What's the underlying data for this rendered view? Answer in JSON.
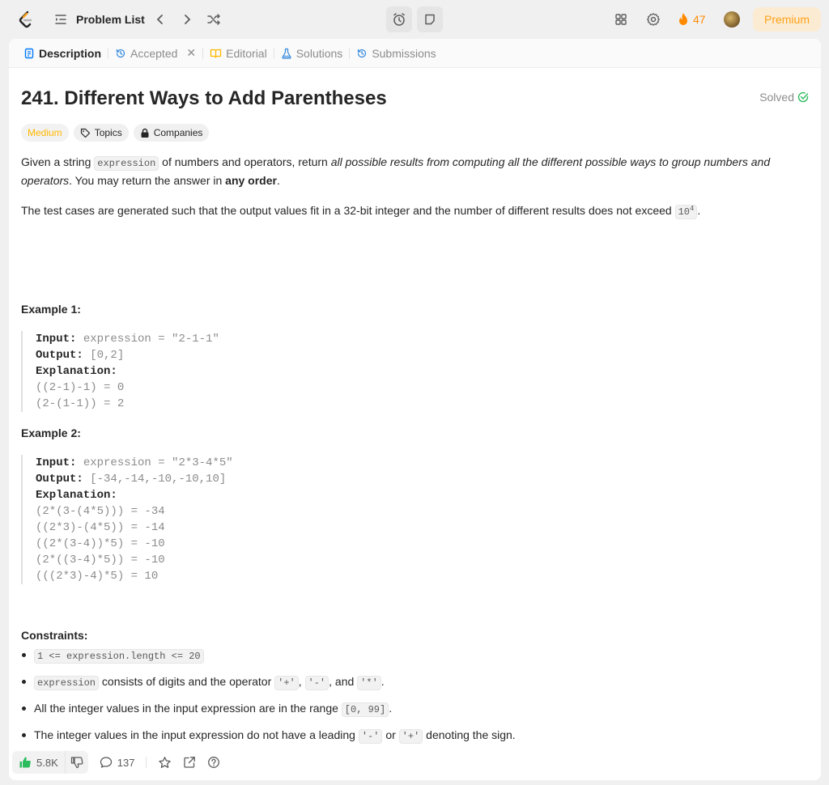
{
  "topbar": {
    "problem_list_label": "Problem List",
    "streak_count": "47",
    "premium_label": "Premium",
    "accent_color": "#ffa116"
  },
  "tabs": [
    {
      "label": "Description",
      "icon": "description-icon",
      "active": true
    },
    {
      "label": "Accepted",
      "icon": "history-icon",
      "closable": true
    },
    {
      "label": "Editorial",
      "icon": "book-icon"
    },
    {
      "label": "Solutions",
      "icon": "flask-icon"
    },
    {
      "label": "Submissions",
      "icon": "history-icon"
    }
  ],
  "problem": {
    "title": "241. Different Ways to Add Parentheses",
    "status": "Solved",
    "difficulty": "Medium",
    "topics_label": "Topics",
    "companies_label": "Companies",
    "desc": {
      "p1_a": "Given a string ",
      "p1_code": "expression",
      "p1_b": " of numbers and operators, return ",
      "p1_em": "all possible results from computing all the different possible ways to group numbers and operators",
      "p1_c": ". You may return the answer in ",
      "p1_strong": "any order",
      "p1_d": ".",
      "p2_a": "The test cases are generated such that the output values fit in a 32-bit integer and the number of different results does not exceed ",
      "p2_base": "10",
      "p2_exp": "4",
      "p2_b": "."
    },
    "examples": [
      {
        "heading": "Example 1:",
        "input_label": "Input:",
        "input": " expression = \"2-1-1\"",
        "output_label": "Output:",
        "output": " [0,2]",
        "explanation_label": "Explanation:",
        "explanation": "((2-1)-1) = 0\n(2-(1-1)) = 2"
      },
      {
        "heading": "Example 2:",
        "input_label": "Input:",
        "input": " expression = \"2*3-4*5\"",
        "output_label": "Output:",
        "output": " [-34,-14,-10,-10,10]",
        "explanation_label": "Explanation:",
        "explanation": "(2*(3-(4*5))) = -34\n((2*3)-(4*5)) = -14\n((2*(3-4))*5) = -10\n(2*((3-4)*5)) = -10\n(((2*3)-4)*5) = 10"
      }
    ],
    "constraints_heading": "Constraints:",
    "constraints": {
      "c1_code": "1 <= expression.length <= 20",
      "c2_code": "expression",
      "c2_a": " consists of digits and the operator ",
      "c2_plus": "'+'",
      "c2_sep1": ", ",
      "c2_minus": "'-'",
      "c2_sep2": ", and ",
      "c2_star": "'*'",
      "c2_end": ".",
      "c3_a": "All the integer values in the input expression are in the range ",
      "c3_code": "[0, 99]",
      "c3_end": ".",
      "c4_a": "The integer values in the input expression do not have a leading ",
      "c4_minus": "'-'",
      "c4_or": " or ",
      "c4_plus": "'+'",
      "c4_b": " denoting the sign."
    }
  },
  "footer": {
    "likes": "5.8K",
    "comments": "137"
  }
}
